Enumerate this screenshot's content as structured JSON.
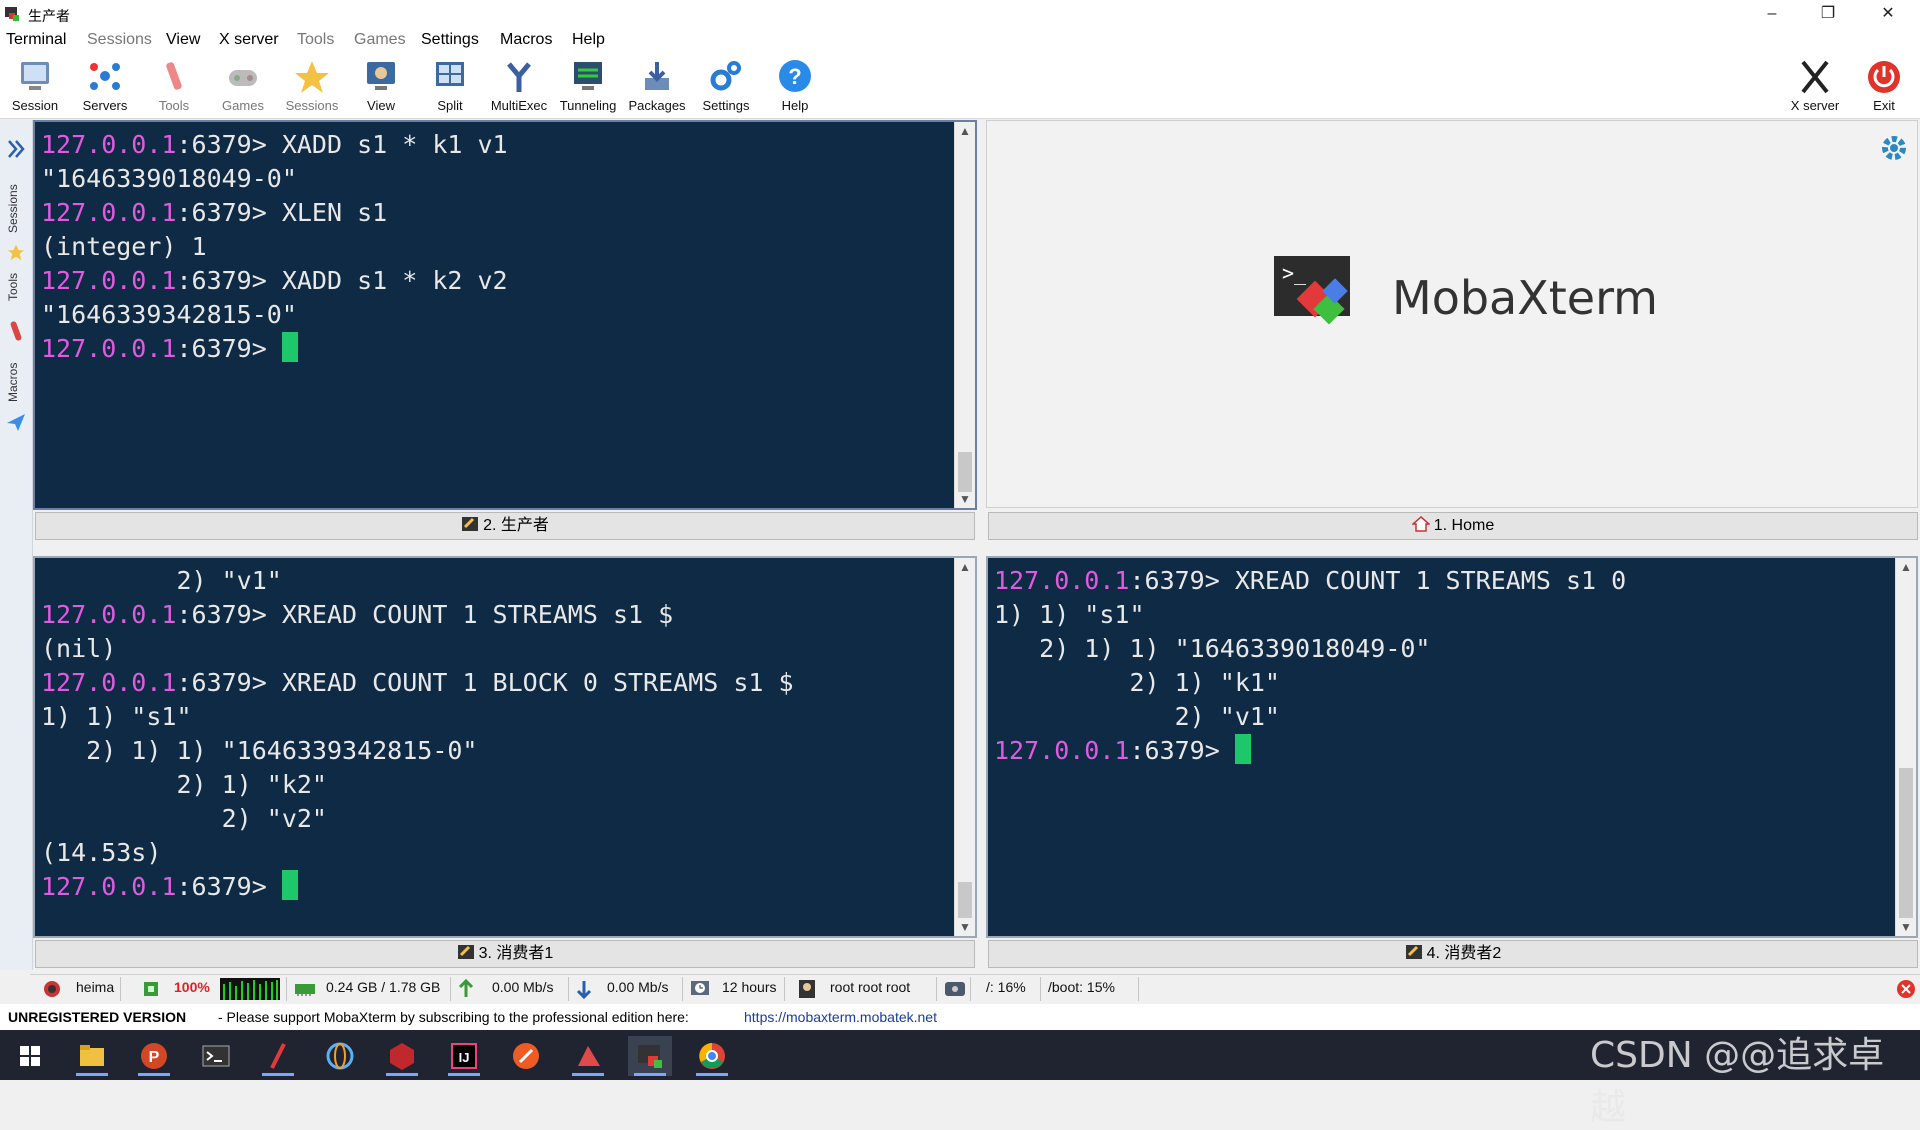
{
  "window": {
    "title": "生产者",
    "minimize": "–",
    "maximize": "❐",
    "close": "✕"
  },
  "menu": [
    "Terminal",
    "Sessions",
    "View",
    "X server",
    "Tools",
    "Games",
    "Settings",
    "Macros",
    "Help"
  ],
  "toolbar": {
    "session": "Session",
    "servers": "Servers",
    "tools": "Tools",
    "games": "Games",
    "sessions": "Sessions",
    "view": "View",
    "split": "Split",
    "multiexec": "MultiExec",
    "tunneling": "Tunneling",
    "packages": "Packages",
    "settings": "Settings",
    "help": "Help",
    "xserver": "X server",
    "exit": "Exit"
  },
  "sidebar": {
    "sessions": "Sessions",
    "tools": "Tools",
    "macros": "Macros"
  },
  "pane_top_left": {
    "tab": "2. 生产者",
    "lines": [
      {
        "prompt": "127.0.0.1",
        "port": ":6379> ",
        "text": "XADD s1 * k1 v1"
      },
      {
        "text": "\"1646339018049-0\""
      },
      {
        "prompt": "127.0.0.1",
        "port": ":6379> ",
        "text": "XLEN s1"
      },
      {
        "text": "(integer) 1"
      },
      {
        "prompt": "127.0.0.1",
        "port": ":6379> ",
        "text": "XADD s1 * k2 v2"
      },
      {
        "text": "\"1646339342815-0\""
      },
      {
        "prompt": "127.0.0.1",
        "port": ":6379> ",
        "text": "",
        "cursor": true
      }
    ]
  },
  "pane_home": {
    "tab": "1. Home",
    "logo": "MobaXterm"
  },
  "pane_bottom_left": {
    "tab": "3. 消费者1",
    "lines": [
      {
        "text": "         2) \"v1\""
      },
      {
        "prompt": "127.0.0.1",
        "port": ":6379> ",
        "text": "XREAD COUNT 1 STREAMS s1 $"
      },
      {
        "text": "(nil)"
      },
      {
        "prompt": "127.0.0.1",
        "port": ":6379> ",
        "text": "XREAD COUNT 1 BLOCK 0 STREAMS s1 $"
      },
      {
        "text": "1) 1) \"s1\""
      },
      {
        "text": "   2) 1) 1) \"1646339342815-0\""
      },
      {
        "text": "         2) 1) \"k2\""
      },
      {
        "text": "            2) \"v2\""
      },
      {
        "text": "(14.53s)"
      },
      {
        "prompt": "127.0.0.1",
        "port": ":6379> ",
        "text": "",
        "cursor": true
      }
    ]
  },
  "pane_bottom_right": {
    "tab": "4. 消费者2",
    "lines": [
      {
        "prompt": "127.0.0.1",
        "port": ":6379> ",
        "text": "XREAD COUNT 1 STREAMS s1 0"
      },
      {
        "text": "1) 1) \"s1\""
      },
      {
        "text": "   2) 1) 1) \"1646339018049-0\""
      },
      {
        "text": "         2) 1) \"k1\""
      },
      {
        "text": "            2) \"v1\""
      },
      {
        "prompt": "127.0.0.1",
        "port": ":6379> ",
        "text": "",
        "cursor": true
      }
    ]
  },
  "status": {
    "host": "heima",
    "cpu": "100%",
    "memory": "0.24 GB / 1.78 GB",
    "upload": "0.00 Mb/s",
    "download": "0.00 Mb/s",
    "uptime": "12 hours",
    "users": "root  root  root",
    "disk_root": "/: 16%",
    "disk_boot": "/boot: 15%"
  },
  "unregistered": {
    "label": "UNREGISTERED VERSION",
    "message": "-  Please support MobaXterm by subscribing to the professional edition here:",
    "link": "https://mobaxterm.mobatek.net"
  },
  "watermark": "CSDN @@追求卓越",
  "colors": {
    "terminal_bg": "#0f2a44",
    "prompt_ip": "#e15be0",
    "cursor": "#1ec86a"
  }
}
